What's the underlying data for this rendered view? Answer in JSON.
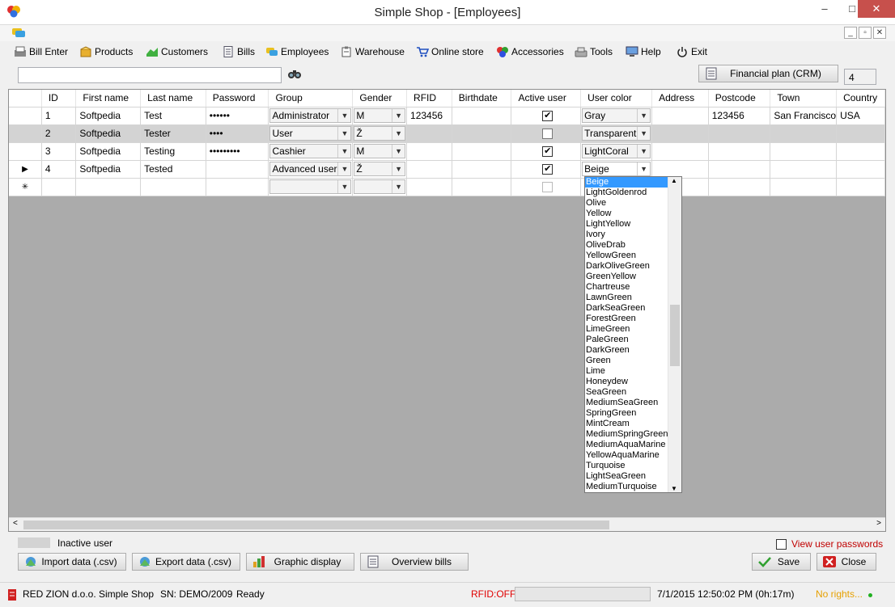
{
  "window": {
    "title": "Simple Shop - [Employees]",
    "minimize": "–",
    "maximize": "□",
    "close": "✕"
  },
  "mdi": {
    "minimize": "_",
    "restore": "▫",
    "close": "✕"
  },
  "menu": [
    {
      "label": "Bill Enter",
      "icon": "bill-enter-icon"
    },
    {
      "label": "Products",
      "icon": "products-icon"
    },
    {
      "label": "Customers",
      "icon": "customers-icon"
    },
    {
      "label": "Bills",
      "icon": "bills-icon"
    },
    {
      "label": "Employees",
      "icon": "employees-icon"
    },
    {
      "label": "Warehouse",
      "icon": "warehouse-icon"
    },
    {
      "label": "Online store",
      "icon": "cart-icon"
    },
    {
      "label": "Accessories",
      "icon": "accessories-icon"
    },
    {
      "label": "Tools",
      "icon": "tools-icon"
    },
    {
      "label": "Help",
      "icon": "help-icon"
    },
    {
      "label": "Exit",
      "icon": "power-icon"
    }
  ],
  "search": {
    "value": "",
    "financial_plan_label": "Financial plan (CRM)",
    "count": "4"
  },
  "grid": {
    "columns": [
      "ID",
      "First name",
      "Last name",
      "Password",
      "Group",
      "Gender",
      "RFID",
      "Birthdate",
      "Active user",
      "User color",
      "Address",
      "Postcode",
      "Town",
      "Country"
    ],
    "rows": [
      {
        "indicator": "",
        "id": "1",
        "first": "Softpedia",
        "last": "Test",
        "password": "••••••",
        "group": "Administrator",
        "gender": "M",
        "rfid": "123456",
        "birthdate": "",
        "active": true,
        "color": "Gray",
        "address": "",
        "postcode": "123456",
        "town": "San Francisco",
        "country": "USA"
      },
      {
        "indicator": "",
        "id": "2",
        "first": "Softpedia",
        "last": "Tester",
        "password": "••••",
        "group": "User",
        "gender": "Ž",
        "rfid": "",
        "birthdate": "",
        "active": false,
        "color": "Transparent",
        "address": "",
        "postcode": "",
        "town": "",
        "country": ""
      },
      {
        "indicator": "",
        "id": "3",
        "first": "Softpedia",
        "last": "Testing",
        "password": "•••••••••",
        "group": "Cashier",
        "gender": "M",
        "rfid": "",
        "birthdate": "",
        "active": true,
        "color": "LightCoral",
        "address": "",
        "postcode": "",
        "town": "",
        "country": ""
      },
      {
        "indicator": "▶",
        "id": "4",
        "first": "Softpedia",
        "last": "Tested",
        "password": "",
        "group": "Advanced user",
        "gender": "Ž",
        "rfid": "",
        "birthdate": "",
        "active": true,
        "color": "Beige",
        "address": "",
        "postcode": "",
        "town": "",
        "country": ""
      }
    ],
    "new_row_indicator": "✳",
    "color_options": [
      "Beige",
      "LightGoldenrod",
      "Olive",
      "Yellow",
      "LightYellow",
      "Ivory",
      "OliveDrab",
      "YellowGreen",
      "DarkOliveGreen",
      "GreenYellow",
      "Chartreuse",
      "LawnGreen",
      "DarkSeaGreen",
      "ForestGreen",
      "LimeGreen",
      "PaleGreen",
      "DarkGreen",
      "Green",
      "Lime",
      "Honeydew",
      "SeaGreen",
      "MediumSeaGreen",
      "SpringGreen",
      "MintCream",
      "MediumSpringGreen",
      "MediumAquaMarine",
      "YellowAquaMarine",
      "Turquoise",
      "LightSeaGreen",
      "MediumTurquoise"
    ],
    "selected_color": "Beige"
  },
  "legend": {
    "inactive_user": "Inactive user"
  },
  "view_passwords": "View user passwords",
  "buttons": {
    "import": "Import data (.csv)",
    "export": "Export data (.csv)",
    "graphic": "Graphic display",
    "overview": "Overview bills",
    "save": "Save",
    "close": "Close"
  },
  "status": {
    "company": "RED ZION d.o.o.",
    "app": "Simple Shop",
    "sn": "SN:  DEMO/2009",
    "state": "Ready",
    "rfid": "RFID:OFF",
    "datetime": "7/1/2015 12:50:02 PM (0h:17m)",
    "rights": "No rights...",
    "rights_color": "#e6a000",
    "rfid_color": "#e00000"
  }
}
